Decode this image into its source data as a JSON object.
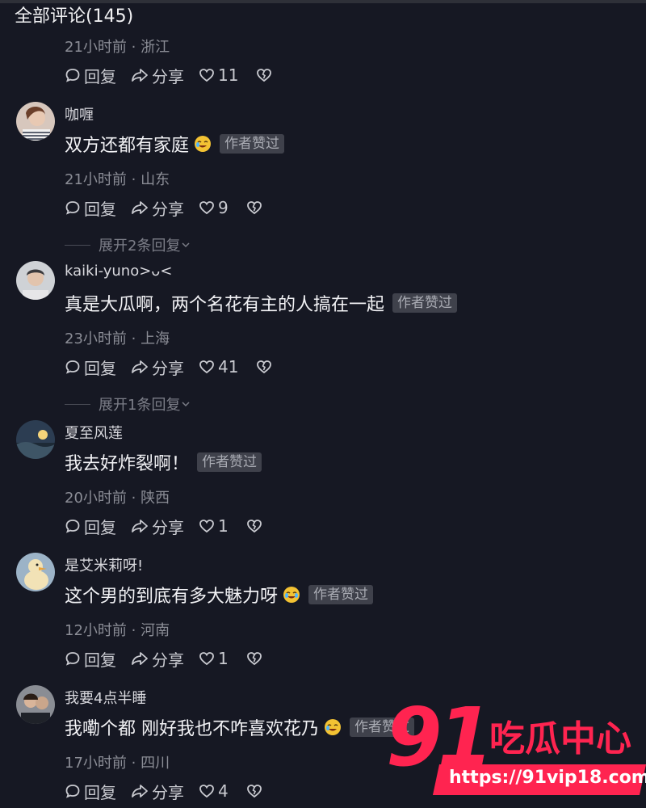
{
  "header": {
    "title": "全部评论(145)"
  },
  "first_comment": {
    "meta": "21小时前 · 浙江",
    "reply_label": "回复",
    "share_label": "分享",
    "likes": "11"
  },
  "comments": [
    {
      "name": "咖喱",
      "text": "双方还都有家庭",
      "has_emoji": true,
      "badge": "作者赞过",
      "meta": "21小时前 · 山东",
      "reply_label": "回复",
      "share_label": "分享",
      "likes": "9",
      "expand": "展开2条回复"
    },
    {
      "name": "kaiki-yuno>ᴗ<",
      "text": "真是大瓜啊，两个名花有主的人搞在一起",
      "has_emoji": false,
      "badge": "作者赞过",
      "meta": "23小时前 · 上海",
      "reply_label": "回复",
      "share_label": "分享",
      "likes": "41",
      "expand": "展开1条回复"
    },
    {
      "name": "夏至风莲",
      "text": "我去好炸裂啊！",
      "has_emoji": false,
      "badge": "作者赞过",
      "meta": "20小时前 · 陕西",
      "reply_label": "回复",
      "share_label": "分享",
      "likes": "1"
    },
    {
      "name": "是艾米莉呀!",
      "text": "这个男的到底有多大魅力呀",
      "has_emoji": true,
      "badge": "作者赞过",
      "meta": "12小时前 · 河南",
      "reply_label": "回复",
      "share_label": "分享",
      "likes": "1"
    },
    {
      "name": "我要4点半睡",
      "text": "我嘞个都 刚好我也不咋喜欢花乃",
      "has_emoji": true,
      "badge": "作者赞过",
      "meta": "17小时前 · 四川",
      "reply_label": "回复",
      "share_label": "分享",
      "likes": "4"
    }
  ],
  "watermark": {
    "number": "91",
    "title": "吃瓜中心",
    "url": "https://91vip18.com"
  },
  "colors": {
    "background": "#161823",
    "badge_bg": "#3f414b",
    "meta_text": "#8b8d96",
    "watermark": "#ff2450"
  },
  "icons": [
    "comment-icon",
    "share-icon",
    "heart-icon",
    "dislike-icon",
    "emoji-icon",
    "chevron-down-icon"
  ]
}
